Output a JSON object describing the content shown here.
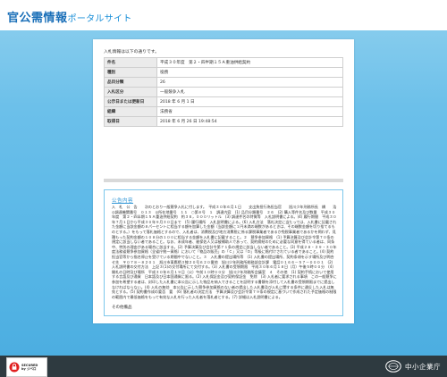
{
  "header": {
    "logo_main": "官公需情報",
    "logo_sub": "ポータルサイト"
  },
  "intro": "入札情報は以下の通りです。",
  "info_table": [
    {
      "label": "件名",
      "value": "平成３０年度　第２・四半期１５Ａ重油供給契約"
    },
    {
      "label": "種別",
      "value": "役務"
    },
    {
      "label": "品目分類",
      "value": "26"
    },
    {
      "label": "入札区分",
      "value": "一般競争入札"
    },
    {
      "label": "公示日または更新日",
      "value": "2018 年 6 月 1 日"
    },
    {
      "label": "組織",
      "value": "法務省"
    },
    {
      "label": "取得日",
      "value": "2018 年 6 月 26 日 19:48:54"
    }
  ],
  "notice": {
    "title": "公告内容",
    "body": "入　札　公　告　　次のとおり一般競争入札に付します。　平成３０年６月１日　　支出負担行為担当官　　旭川少年刑務所長　橋　　浩　　◎調達機関番号　０１３　◎所在地番号　１１　○第８号　１　調達内容　(1) 品目分類番号　２６　(2) 購入等件名及び数量　平成３０年度　第２・四半期１５Ａ重油供給契約　約３６，０００リットル　(3) 調達件名の特質等　入札説明書による。(4) 履行期間　平成３０年７月１日から平成３０年９月３０日まで　(5) 履行場所　入札説明書による。(6) 入札方法　落札決定に当たっては、入札書に記載された金額に当該金額の８パーセントに相当する額を加算した金額（当該金額に１円未満の端数があるときは、その端数金額を切り捨てるものとする。）をもって落札価格とするので、入札者は、消費税及び地方消費税に係る課税事業者であるか免税事業者であるかを問わず、見積もった契約金額の１０８分の１００に相当する金額を入札書に記載すること。２　競争参加資格　(1) 予算決算及び会計令第７０条の規定に該当しない者であること。なお、未成年者、被保佐人又は被補助人であって、契約締結のために必要な同意を得ている者は、同条中、特別の理由がある場合に該当する。(2) 予算決算及び会計令第７１条の規定に該当しない者であること。(3) 平成２８・２９・３０年度法務省競争参加資格（全省庁統一資格）において「物品の販売」の「Ｃ」又は「Ｄ」等級に格付けされている者であること。(4) 契約担当官等から指名停止を受けている期間中でないこと。３　入札書の提出場所等　(1) 入札書の提出場所、契約条項を示す場所及び問合せ先　〒０７８－８２０１　旭川市東鷹栖３線２０号６２０番地　旭川少年刑務所総務部会計課　電話０１６６－５７－０００１　(2) 入札説明書の交付方法　上記３(1)の交付場所にて交付する。(3) 入札書の受領期限　平成３０年６月１８日（月）午後５時００分　(4) 開札の日時及び場所　平成３０年６月１９日（火）午前１０時００分　旭川少年刑務所会議室　４　その他　(1) 契約手続において使用する言語及び通貨　日本語及び日本国通貨に限る。(2) 入札保証金及び契約保証金　免除　(3) 入札者に要求される事項　この一般競争に参加を希望する者は、封印した入札書に本公告に示した物品を納入できることを証明する書類を添付して入札書の受領期限までに提出しなければならない。(4) 入札の無効　本公告に示した競争参加資格のない者の提出した入札書及び入札に関する条件に違反した入札は無効とする。(5) 契約書作成の要否　要　(6) 落札者の決定方法　予算決算及び会計令第７９条の規定に基づいて作成された予定価格の制限の範囲内で最低価格をもって有効な入札を行った入札者を落札者とする。(7) 詳細は入札説明書による。",
    "footer": "その他備品"
  },
  "footer": {
    "seal_line1": "SECURED",
    "seal_line2": "by ジベロ",
    "agency": "中小企業庁"
  }
}
